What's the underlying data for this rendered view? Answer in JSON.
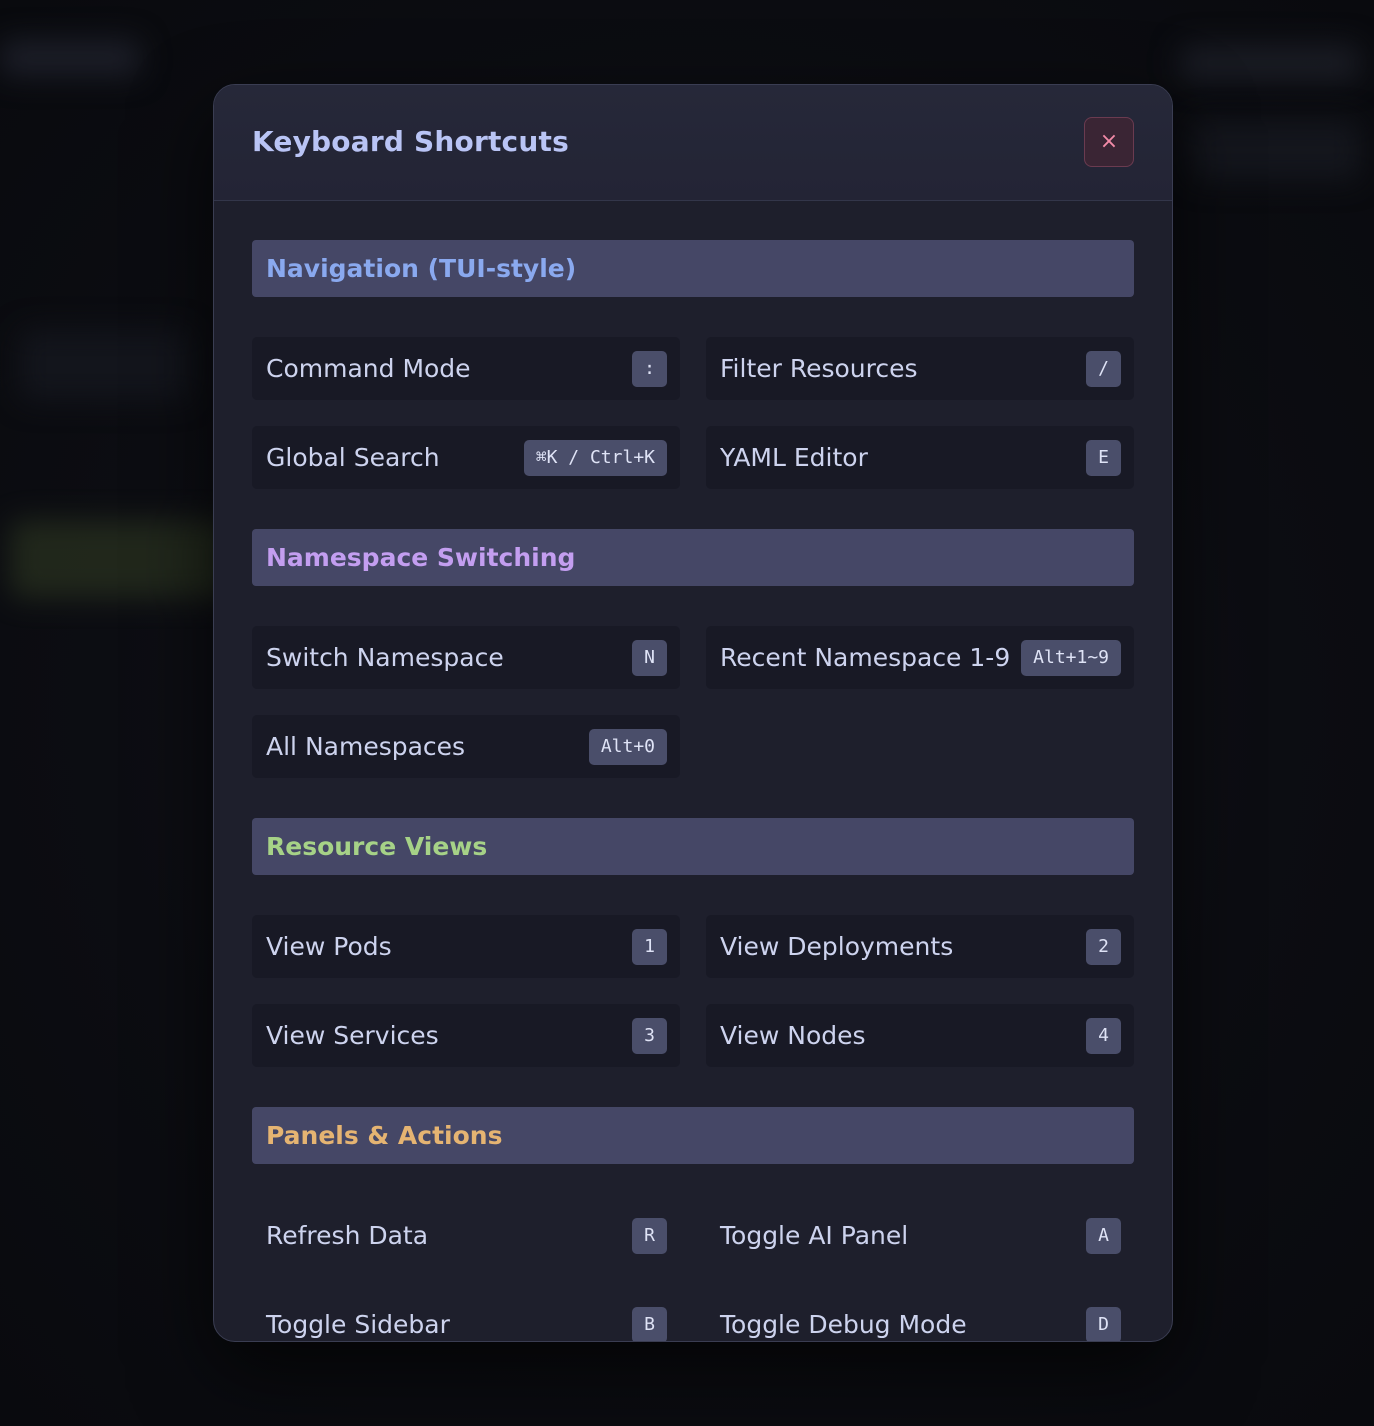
{
  "modal": {
    "title": "Keyboard Shortcuts",
    "close_label": "×"
  },
  "sections": [
    {
      "title": "Navigation (TUI-style)",
      "color": "#8aa9ef",
      "items": [
        {
          "label": "Command Mode",
          "key": ":"
        },
        {
          "label": "Filter Resources",
          "key": "/"
        },
        {
          "label": "Global Search",
          "key": "⌘K / Ctrl+K"
        },
        {
          "label": "YAML Editor",
          "key": "E"
        }
      ]
    },
    {
      "title": "Namespace Switching",
      "color": "#c39ef0",
      "items": [
        {
          "label": "Switch Namespace",
          "key": "N"
        },
        {
          "label": "Recent Namespace 1-9",
          "key": "Alt+1~9"
        },
        {
          "label": "All Namespaces",
          "key": "Alt+0"
        }
      ]
    },
    {
      "title": "Resource Views",
      "color": "#a6d287",
      "items": [
        {
          "label": "View Pods",
          "key": "1"
        },
        {
          "label": "View Deployments",
          "key": "2"
        },
        {
          "label": "View Services",
          "key": "3"
        },
        {
          "label": "View Nodes",
          "key": "4"
        }
      ]
    },
    {
      "title": "Panels & Actions",
      "color": "#e5b472",
      "items": [
        {
          "label": "Refresh Data",
          "key": "R"
        },
        {
          "label": "Toggle AI Panel",
          "key": "A"
        },
        {
          "label": "Toggle Sidebar",
          "key": "B"
        },
        {
          "label": "Toggle Debug Mode",
          "key": "D"
        }
      ]
    }
  ]
}
